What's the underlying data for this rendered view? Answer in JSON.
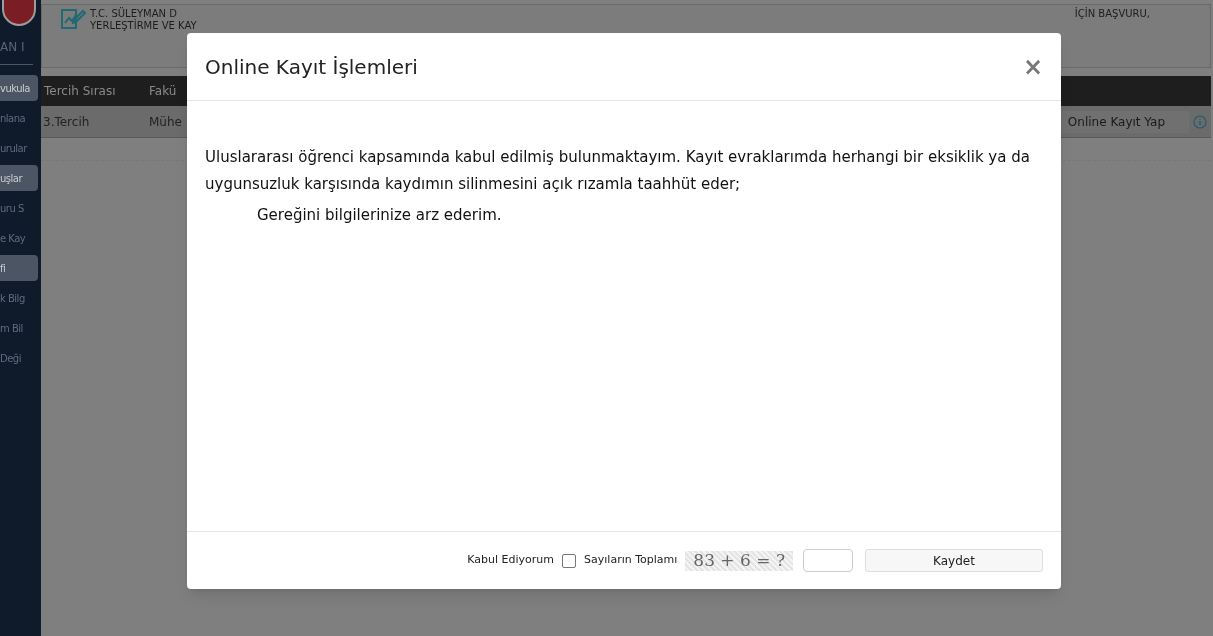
{
  "sidebar": {
    "heading": "AN I",
    "items": [
      {
        "label": "vukula",
        "selected": true
      },
      {
        "label": "nlana",
        "selected": false
      },
      {
        "label": "urular",
        "selected": false
      },
      {
        "label": "uşlar",
        "selected": true
      },
      {
        "label": "uru S",
        "selected": false
      },
      {
        "label": "e Kay",
        "selected": false
      },
      {
        "label": "fi",
        "selected": true
      },
      {
        "label": "k Bilg",
        "selected": false
      },
      {
        "label": "m Bil",
        "selected": false
      },
      {
        "label": "Deği",
        "selected": false
      }
    ]
  },
  "header": {
    "title_start": "T.C. SÜLEYMAN D",
    "title_end": "İÇİN BAŞVURU,",
    "subtitle": "YERLEŞTİRME VE KAY"
  },
  "table": {
    "columns": [
      "Tercih Sırası",
      "Fakü"
    ],
    "rows": [
      {
        "cells": [
          "3.Tercih",
          "Mühe"
        ],
        "action": "Online Kayıt Yap"
      }
    ]
  },
  "modal": {
    "title": "Online Kayıt İşlemleri",
    "close": "×",
    "paragraph": "Uluslararası öğrenci kapsamında kabul edilmiş bulunmaktayım. Kayıt evraklarımda herhangi bir eksiklik ya da uygunsuzluk karşısında kaydımın silinmesini açık rızamla taahhüt eder;",
    "closing": "Gereğini bilgilerinize arz ederim.",
    "footer": {
      "accept_label": "Kabul Ediyorum",
      "accept_checked": false,
      "sum_label": "Sayıların Toplamı",
      "captcha": "83 + 6 = ?",
      "save": "Kaydet"
    }
  }
}
